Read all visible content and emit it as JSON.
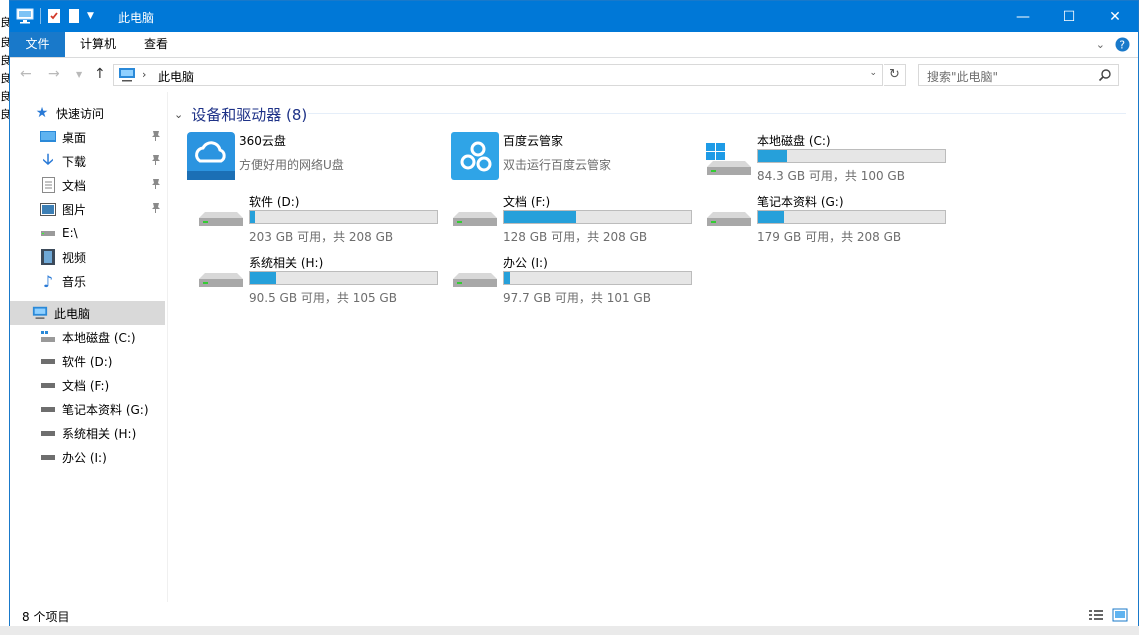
{
  "window": {
    "title": "此电脑"
  },
  "ribbon": {
    "tabs": [
      {
        "label": "文件"
      },
      {
        "label": "计算机"
      },
      {
        "label": "查看"
      }
    ]
  },
  "address": {
    "crumb": "此电脑",
    "search_placeholder": "搜索\"此电脑\""
  },
  "nav": {
    "quick_access": "快速访问",
    "items": [
      {
        "label": "桌面",
        "icon": "desktop-icon",
        "pinned": true
      },
      {
        "label": "下载",
        "icon": "download-icon",
        "pinned": true
      },
      {
        "label": "文档",
        "icon": "document-icon",
        "pinned": true
      },
      {
        "label": "图片",
        "icon": "picture-icon",
        "pinned": true
      },
      {
        "label": "E:\\",
        "icon": "drive-icon",
        "pinned": false
      },
      {
        "label": "视频",
        "icon": "video-icon",
        "pinned": false
      },
      {
        "label": "音乐",
        "icon": "music-icon",
        "pinned": false
      }
    ],
    "this_pc": "此电脑",
    "drives": [
      {
        "label": "本地磁盘 (C:)"
      },
      {
        "label": "软件 (D:)"
      },
      {
        "label": "文档 (F:)"
      },
      {
        "label": "笔记本资料 (G:)"
      },
      {
        "label": "系统相关 (H:)"
      },
      {
        "label": "办公 (I:)"
      }
    ]
  },
  "content": {
    "group_title": "设备和驱动器 (8)",
    "apps": [
      {
        "name": "360云盘",
        "subtitle": "方便好用的网络U盘",
        "icon": "cloud-icon"
      },
      {
        "name": "百度云管家",
        "subtitle": "双击运行百度云管家",
        "icon": "baidu-cloud-icon"
      }
    ],
    "drives": [
      {
        "name": "本地磁盘 (C:)",
        "info": "84.3 GB 可用，共 100 GB",
        "used_fraction": 0.157
      },
      {
        "name": "软件 (D:)",
        "info": "203 GB 可用，共 208 GB",
        "used_fraction": 0.024
      },
      {
        "name": "文档 (F:)",
        "info": "128 GB 可用，共 208 GB",
        "used_fraction": 0.385
      },
      {
        "name": "笔记本资料 (G:)",
        "info": "179 GB 可用，共 208 GB",
        "used_fraction": 0.139
      },
      {
        "name": "系统相关 (H:)",
        "info": "90.5 GB 可用，共 105 GB",
        "used_fraction": 0.138
      },
      {
        "name": "办公 (I:)",
        "info": "97.7 GB 可用，共 101 GB",
        "used_fraction": 0.033
      }
    ]
  },
  "status": {
    "text": "8 个项目"
  },
  "colors": {
    "accent": "#0078d7",
    "bar_fill": "#26a0da"
  }
}
